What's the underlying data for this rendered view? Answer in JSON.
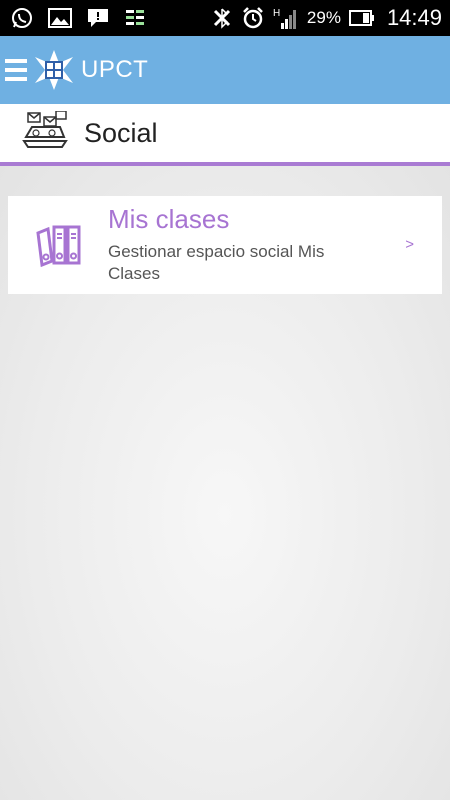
{
  "status_bar": {
    "battery_percent": "29%",
    "time": "14:49",
    "signal_type": "H",
    "icons": [
      "whatsapp-icon",
      "gallery-icon",
      "chat-icon",
      "data-icon",
      "bluetooth-icon",
      "alarm-icon",
      "signal-icon",
      "battery-icon"
    ]
  },
  "action_bar": {
    "title": "UPCT",
    "menu_icon": "hamburger-menu-icon",
    "logo_icon": "upct-logo-icon",
    "color": "#6fb0e2"
  },
  "section": {
    "title": "Social",
    "icon": "laptop-social-icon",
    "accent": "#a97bd3"
  },
  "items": [
    {
      "title": "Mis clases",
      "subtitle": "Gestionar espacio social Mis Clases",
      "icon": "binders-icon",
      "chevron": ">"
    }
  ]
}
